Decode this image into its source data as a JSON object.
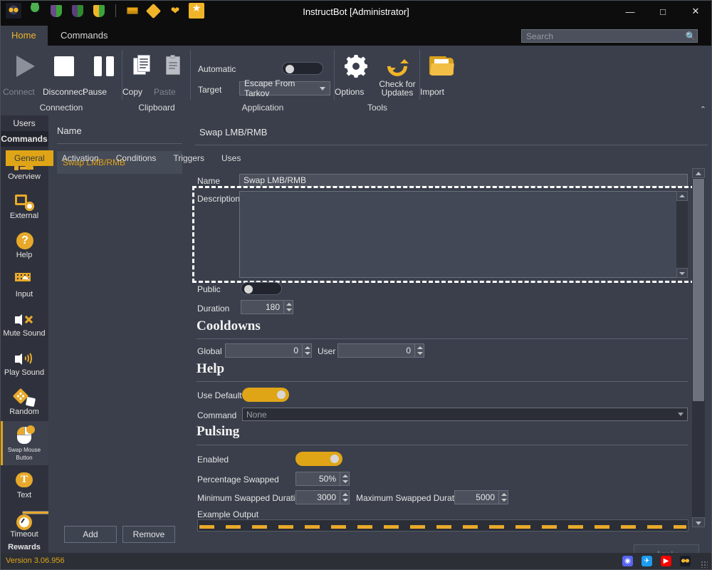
{
  "window": {
    "title": "InstructBot [Administrator]",
    "minimize": "—",
    "maximize": "□",
    "close": "✕"
  },
  "quick_access": [
    {
      "name": "owl-logo-icon"
    },
    {
      "name": "plug-icon"
    },
    {
      "name": "shield-purple-green-icon"
    },
    {
      "name": "shield-purple-green-2-icon"
    },
    {
      "name": "shield-orange-green-icon"
    },
    {
      "name": "coins-icon"
    },
    {
      "name": "tag-icon"
    },
    {
      "name": "heart-icon"
    },
    {
      "name": "star-icon"
    }
  ],
  "ribbon": {
    "tabs": [
      {
        "label": "Home",
        "active": true
      },
      {
        "label": "Commands",
        "active": false
      }
    ],
    "search": {
      "value": "",
      "placeholder": "Search"
    },
    "groups": [
      {
        "label": "Connection",
        "buttons": [
          {
            "label": "Connect",
            "icon": "play-icon",
            "disabled": true
          },
          {
            "label": "Disconnect",
            "icon": "stop-icon",
            "disabled": false
          },
          {
            "label": "Pause",
            "icon": "pause-icon",
            "disabled": false
          }
        ]
      },
      {
        "label": "Clipboard",
        "buttons": [
          {
            "label": "Copy",
            "icon": "copy-icon",
            "disabled": false
          },
          {
            "label": "Paste",
            "icon": "paste-icon",
            "disabled": true
          }
        ]
      },
      {
        "label": "Application",
        "automatic_label": "Automatic",
        "automatic_value": "off",
        "target_label": "Target",
        "target_value": "Escape From Tarkov"
      },
      {
        "label": "Tools",
        "buttons": [
          {
            "label": "Options",
            "icon": "gear-icon"
          },
          {
            "label": "Check for Updates",
            "icon": "refresh-icon"
          },
          {
            "label": "Import",
            "icon": "folder-open-icon"
          }
        ]
      }
    ],
    "collapse_glyph": "⌃"
  },
  "sidebar": {
    "top_items": [
      {
        "label": "Users",
        "selected": false
      },
      {
        "label": "Commands",
        "selected": true
      }
    ],
    "items": [
      {
        "label": "Overview",
        "icon": "overview-icon",
        "active": false
      },
      {
        "label": "External",
        "icon": "external-icon",
        "active": false
      },
      {
        "label": "Help",
        "icon": "help-icon",
        "active": false
      },
      {
        "label": "Input",
        "icon": "input-icon",
        "active": false
      },
      {
        "label": "Mute Sound",
        "icon": "mute-sound-icon",
        "active": false
      },
      {
        "label": "Play Sound",
        "icon": "play-sound-icon",
        "active": false
      },
      {
        "label": "Random",
        "icon": "random-dice-icon",
        "active": false
      },
      {
        "label": "Swap Mouse Button",
        "icon": "swap-mouse-button-icon",
        "active": true
      },
      {
        "label": "Text",
        "icon": "text-bubble-icon",
        "active": false
      },
      {
        "label": "Timeout",
        "icon": "timeout-stopwatch-icon",
        "active": false
      },
      {
        "label": "Rewards",
        "icon": "rewards-icon",
        "active": false
      }
    ]
  },
  "list_panel": {
    "header": "Name",
    "items": [
      {
        "label": "Swap LMB/RMB",
        "selected": true
      }
    ],
    "add_button": "Add",
    "remove_button": "Remove"
  },
  "detail": {
    "title": "Swap LMB/RMB",
    "tabs": [
      {
        "label": "General",
        "active": true
      },
      {
        "label": "Activation",
        "active": false
      },
      {
        "label": "Conditions",
        "active": false
      },
      {
        "label": "Triggers",
        "active": false
      },
      {
        "label": "Uses",
        "active": false
      }
    ],
    "general": {
      "name_label": "Name",
      "name_value": "Swap LMB/RMB",
      "description_label": "Description",
      "description_value": "",
      "public_label": "Public",
      "public_value": "off",
      "duration_label": "Duration",
      "duration_value": "180",
      "cooldowns_heading": "Cooldowns",
      "global_label": "Global",
      "global_value": "0",
      "user_label": "User",
      "user_value": "0",
      "help_heading": "Help",
      "use_default_label": "Use Default",
      "use_default_value": "on",
      "command_label": "Command",
      "command_value": "None",
      "pulsing_heading": "Pulsing",
      "enabled_label": "Enabled",
      "enabled_value": "on",
      "percentage_swapped_label": "Percentage Swapped",
      "percentage_swapped_value": "50%",
      "minimum_swapped_duration_label": "Minimum Swapped Duration",
      "minimum_swapped_duration_value": "3000",
      "maximum_swapped_duration_label": "Maximum Swapped Duration",
      "maximum_swapped_duration_value": "5000",
      "example_output_label": "Example Output"
    },
    "apply_button": "Apply"
  },
  "status_bar": {
    "version": "Version 3.06.956",
    "socials": [
      {
        "name": "discord-icon",
        "glyph": "◑"
      },
      {
        "name": "twitter-icon",
        "glyph": "✉"
      },
      {
        "name": "youtube-icon",
        "glyph": "▶"
      },
      {
        "name": "owl-icon",
        "glyph": ""
      }
    ]
  },
  "colors": {
    "accent": "#e0a517",
    "panel": "#3a3f4b",
    "dark": "#2b2e36",
    "titlebar": "#0d0d0d"
  }
}
